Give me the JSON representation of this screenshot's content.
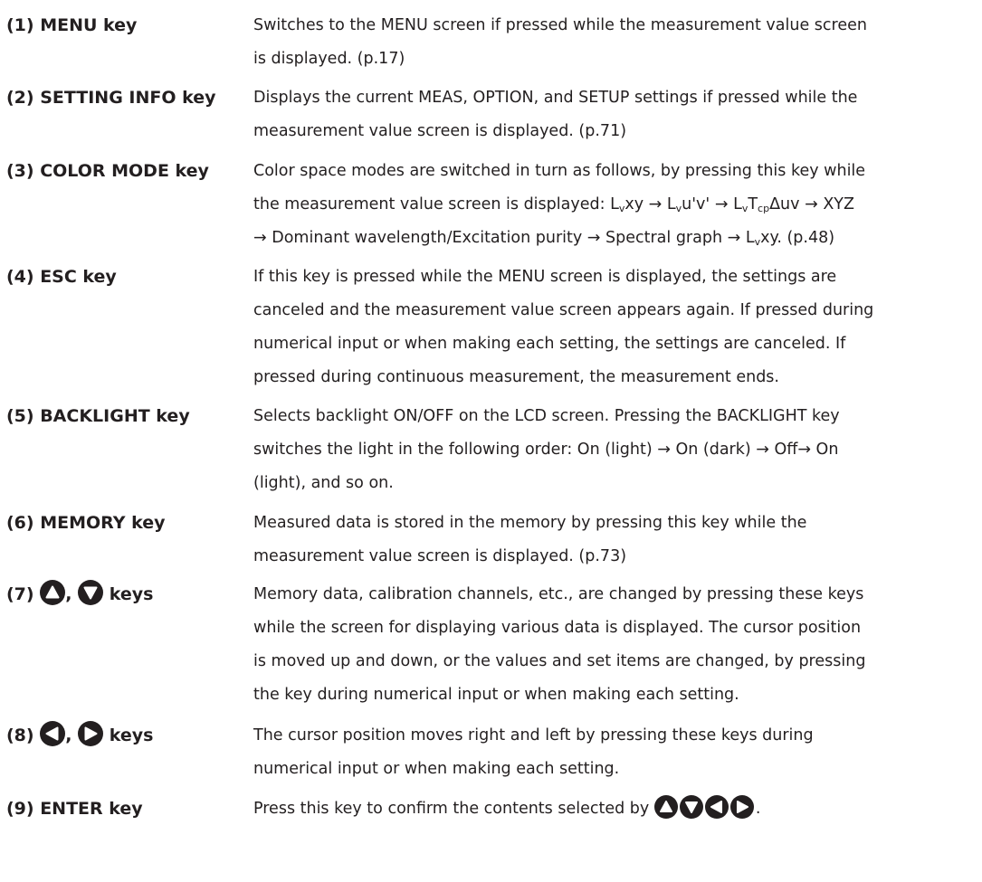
{
  "entries": [
    {
      "key": "(1) MENU key",
      "lines": [
        "Switches to the MENU screen if pressed while the measurement value screen",
        "is displayed. (p.17)"
      ]
    },
    {
      "key": "(2) SETTING INFO key",
      "lines": [
        "Displays the current MEAS, OPTION, and SETUP settings if pressed while the",
        "measurement value screen is displayed. (p.71)"
      ]
    },
    {
      "key": "(3) COLOR MODE key",
      "lines": [
        "Color space modes are switched in turn as follows, by pressing this key while",
        "the measurement value screen is displayed:",
        "→ Dominant wavelength/Excitation purity → Spectral graph →",
        "xy. (p.48)"
      ],
      "modes": {
        "lv": "L",
        "lv_sub": "v",
        "xy": "xy",
        "uv": "u'v'",
        "t": "T",
        "t_sub": "cp",
        "duv": "Δuv",
        "xyz": "XYZ",
        "arrow": "→"
      }
    },
    {
      "key": "(4) ESC key",
      "lines": [
        "If this key is pressed while the MENU screen is displayed, the settings are",
        "canceled and the measurement value screen appears again. If pressed during",
        "numerical input or when making each setting, the settings are canceled. If",
        "pressed during continuous measurement, the measurement ends."
      ]
    },
    {
      "key": "(5) BACKLIGHT key",
      "lines": [
        "Selects backlight ON/OFF on the LCD screen. Pressing the BACKLIGHT key",
        "switches the light in the following order: On (light) → On (dark) → Off→ On",
        "(light), and so on."
      ]
    },
    {
      "key": "(6) MEMORY key",
      "lines": [
        "Measured data is stored in the memory by pressing this key while the",
        "measurement value screen is displayed. (p.73)"
      ]
    },
    {
      "key_prefix": "(7)",
      "key_sep": ",",
      "key_suffix": "keys",
      "lines": [
        "Memory data, calibration channels, etc., are changed by pressing these keys",
        "while the screen for displaying various data is displayed. The cursor position",
        "is moved up and down, or the values and set items are changed, by pressing",
        "the key during numerical input or when making each setting."
      ]
    },
    {
      "key_prefix": "(8)",
      "key_sep": ",",
      "key_suffix": "keys",
      "lines": [
        "The cursor position moves right and left by pressing these keys during",
        "numerical input or when making each setting."
      ]
    },
    {
      "key": "(9) ENTER key",
      "lines": [
        "Press this key to confirm the contents selected by",
        "."
      ]
    }
  ]
}
